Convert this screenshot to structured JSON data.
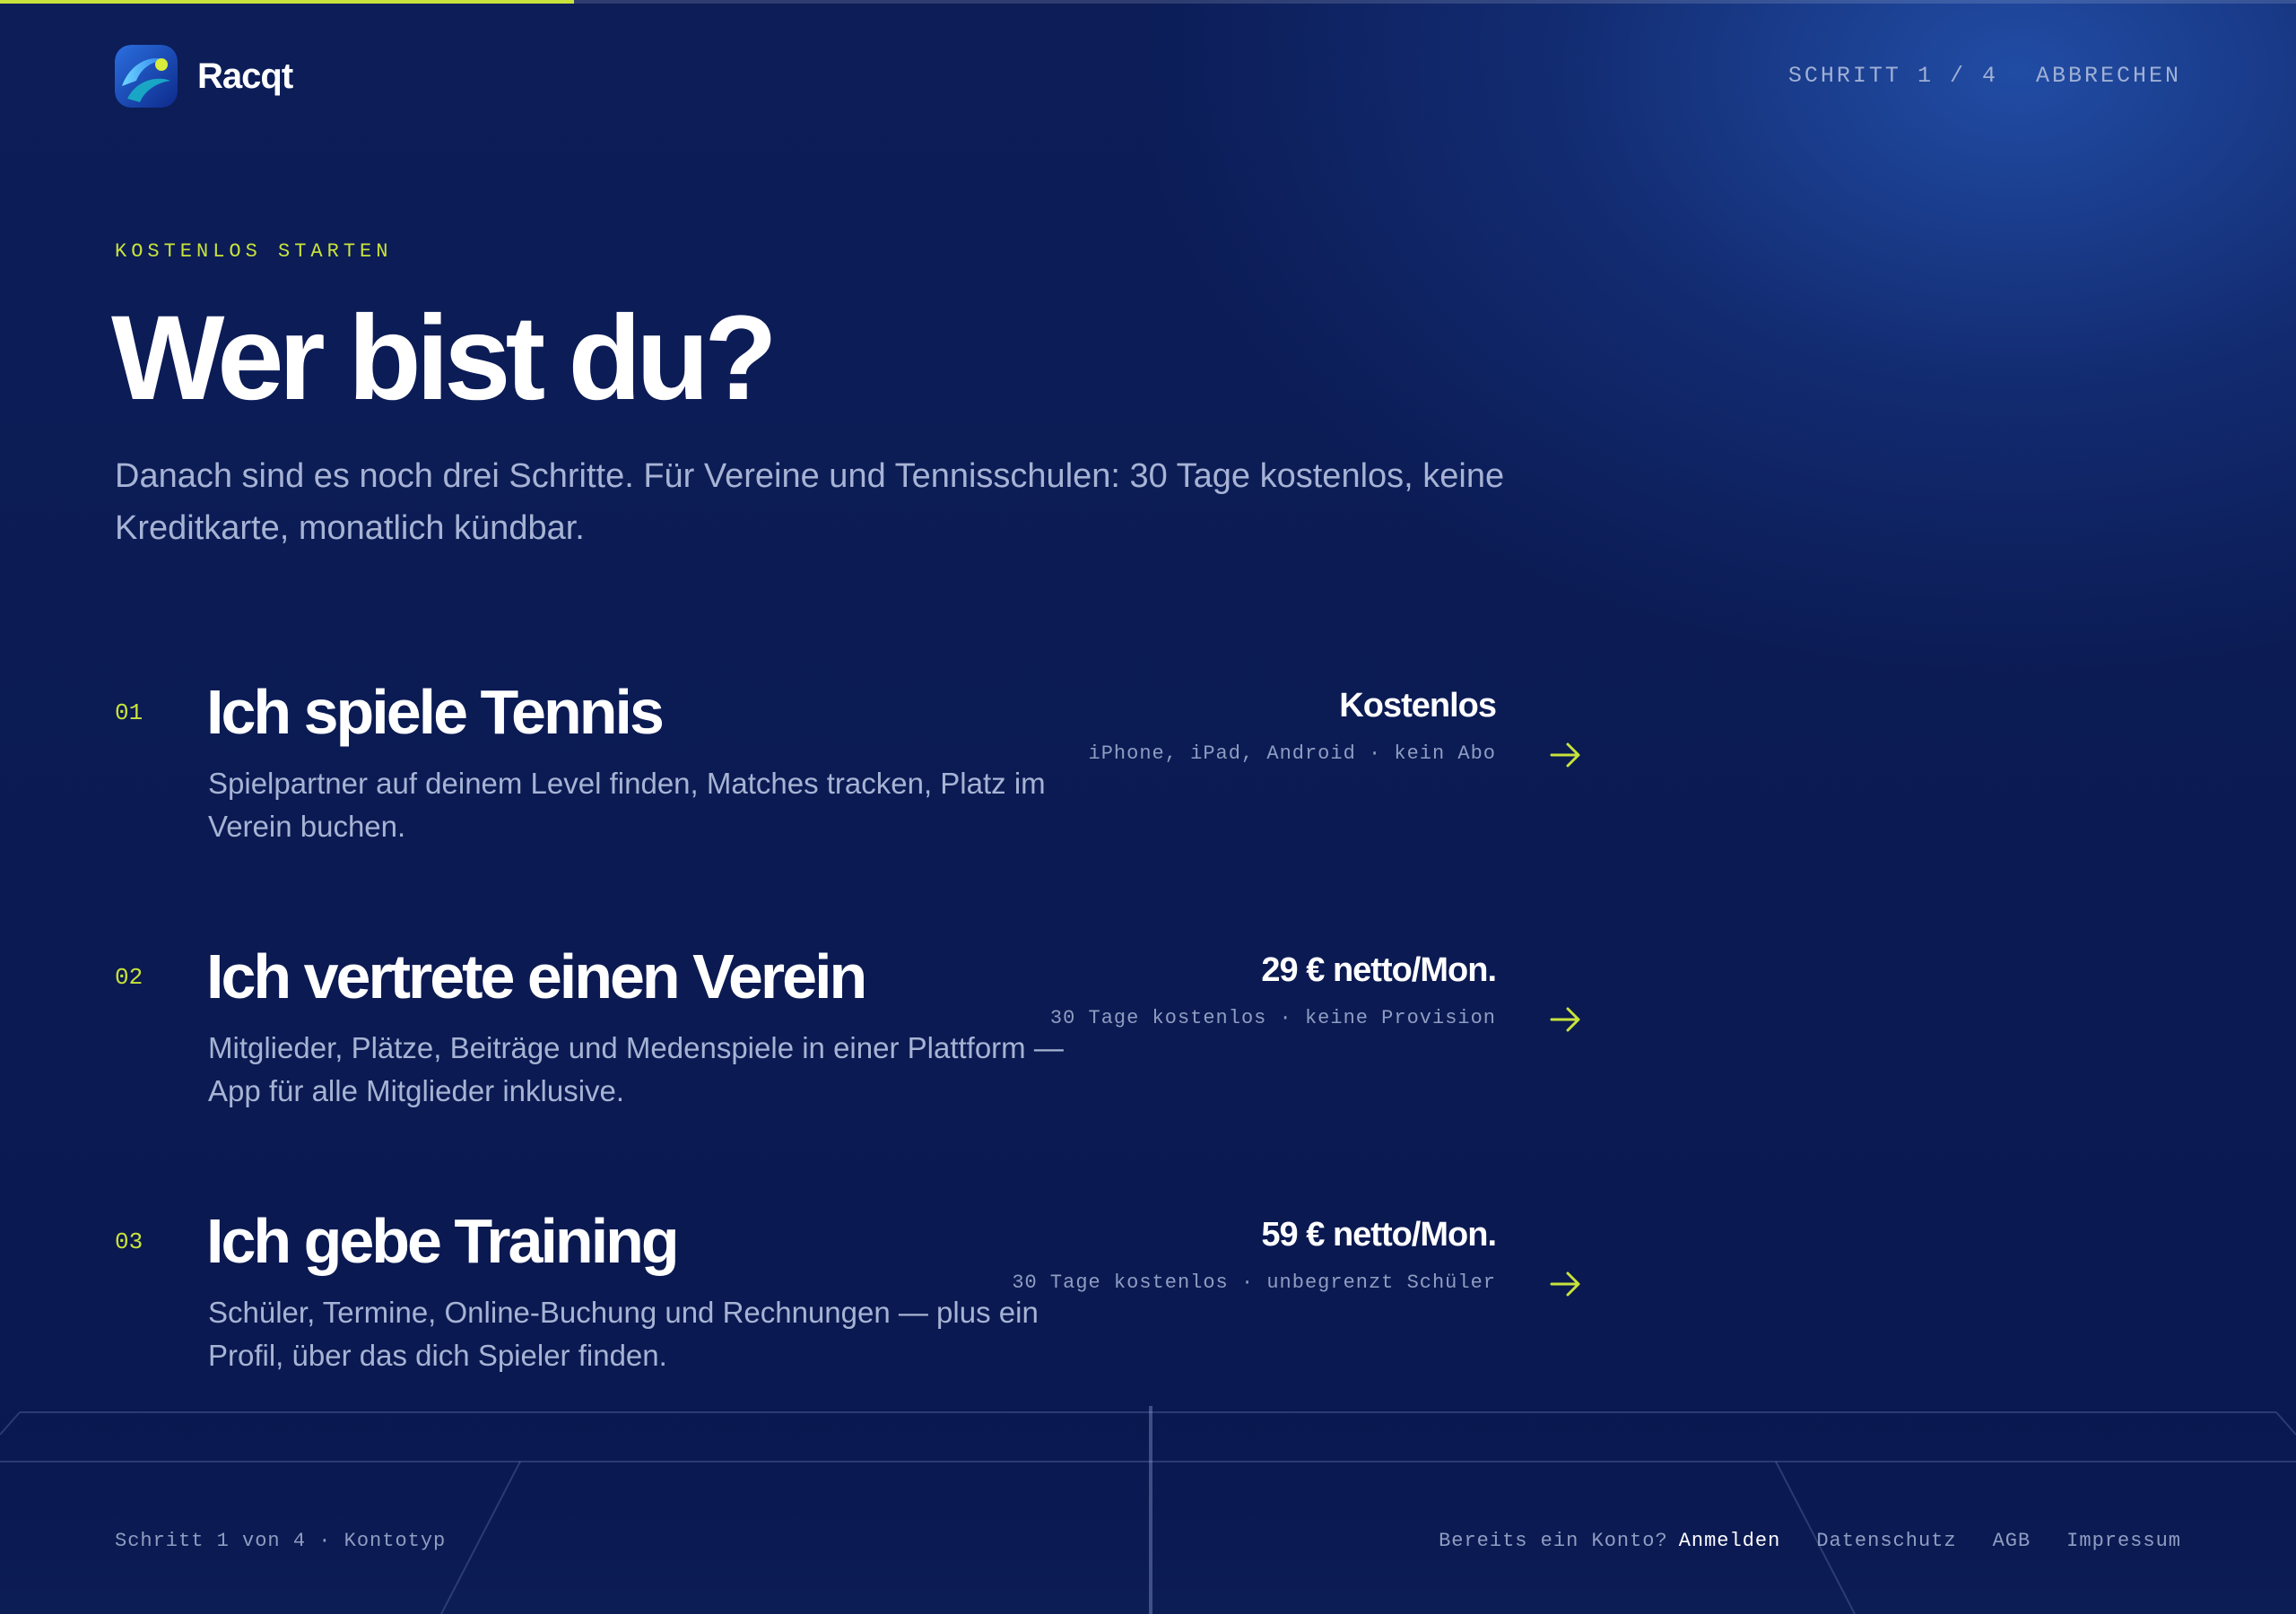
{
  "progress": {
    "fraction": 0.25
  },
  "brand": {
    "name": "Racqt",
    "logo_icon": "racqt-logo-icon"
  },
  "header": {
    "step": "SCHRITT 1 / 4",
    "cancel": "ABBRECHEN"
  },
  "hero": {
    "eyebrow": "KOSTENLOS STARTEN",
    "title": "Wer bist du?",
    "subtitle": "Danach sind es noch drei Schritte. Für Vereine und Tennisschulen: 30 Tage kostenlos, keine Kreditkarte, monatlich kündbar."
  },
  "options": [
    {
      "number": "01",
      "title": "Ich spiele Tennis",
      "description": "Spielpartner auf deinem Level finden, Matches tracken, Platz im Verein buchen.",
      "price": "Kostenlos",
      "meta": "iPhone, iPad, Android · kein Abo",
      "icon": "arrow-right-icon"
    },
    {
      "number": "02",
      "title": "Ich vertrete einen Verein",
      "description": "Mitglieder, Plätze, Beiträge und Medenspiele in einer Plattform — App für alle Mitglieder inklusive.",
      "price": "29 € netto/Mon.",
      "meta": "30 Tage kostenlos · keine Provision",
      "icon": "arrow-right-icon"
    },
    {
      "number": "03",
      "title": "Ich gebe Training",
      "description": "Schüler, Termine, Online-Buchung und Rechnungen — plus ein Profil, über das dich Spieler finden.",
      "price": "59 € netto/Mon.",
      "meta": "30 Tage kostenlos · unbegrenzt Schüler",
      "icon": "arrow-right-icon"
    }
  ],
  "footer": {
    "status": "Schritt 1 von 4 · Kontotyp",
    "account_question": "Bereits ein Konto?",
    "login": "Anmelden",
    "links": [
      "Datenschutz",
      "AGB",
      "Impressum"
    ]
  },
  "colors": {
    "accent": "#c8e33b",
    "background": "#0b1a52",
    "muted_text": "#a6b3d4"
  }
}
